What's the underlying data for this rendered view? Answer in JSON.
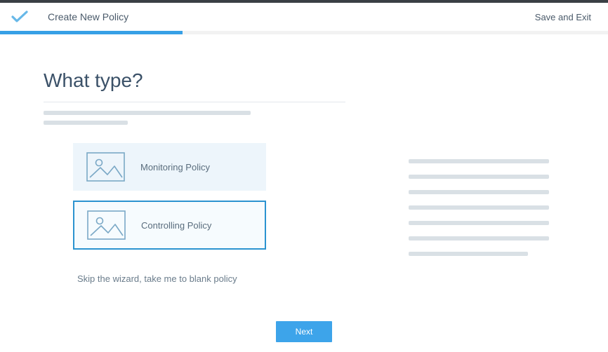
{
  "header": {
    "title": "Create New Policy",
    "save_exit": "Save and Exit"
  },
  "progress": {
    "percent": 30
  },
  "main": {
    "title": "What type?",
    "options": [
      {
        "label": "Monitoring Policy",
        "selected": false
      },
      {
        "label": "Controlling Policy",
        "selected": true
      }
    ],
    "skip_link": "Skip the wizard, take me to blank policy"
  },
  "footer": {
    "next": "Next"
  }
}
